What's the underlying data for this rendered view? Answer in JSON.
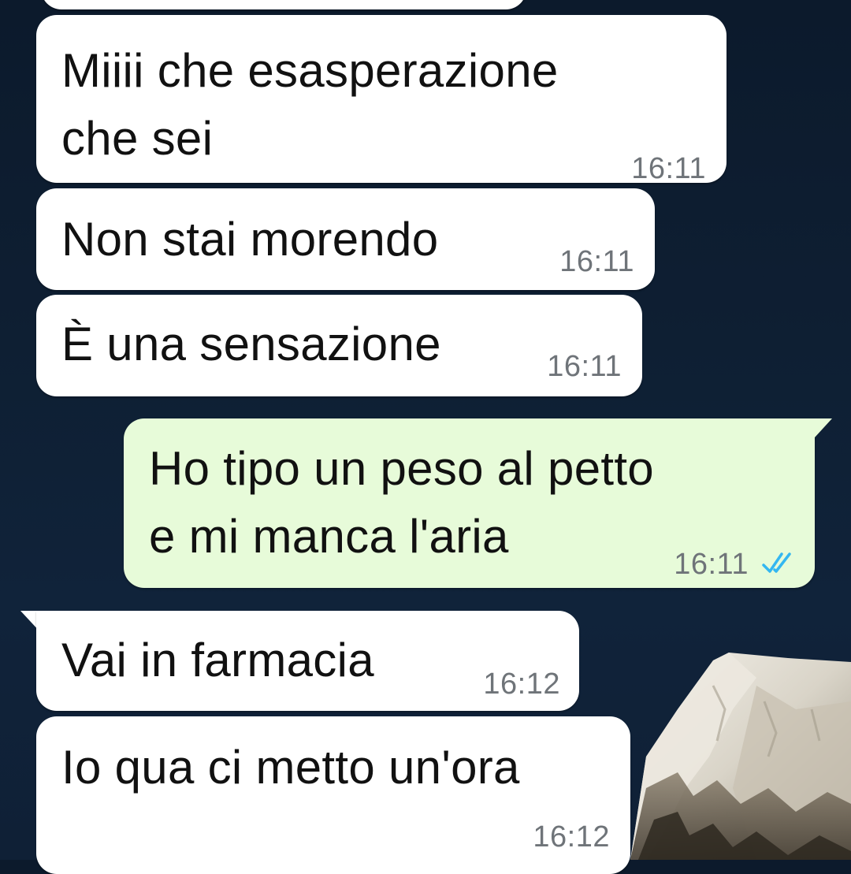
{
  "chat": {
    "messages": [
      {
        "direction": "incoming",
        "text": "",
        "time": ""
      },
      {
        "direction": "incoming",
        "text": "Miiii che esasperazione\nche sei",
        "time": "16:11"
      },
      {
        "direction": "incoming",
        "text": "Non stai morendo",
        "time": "16:11"
      },
      {
        "direction": "incoming",
        "text": "È una sensazione",
        "time": "16:11"
      },
      {
        "direction": "outgoing",
        "text": "Ho tipo un peso al petto\ne mi manca l'aria",
        "time": "16:11",
        "status": "read",
        "status_icon": "double-check-icon",
        "status_color": "#34b7f1"
      },
      {
        "direction": "incoming",
        "text": "Vai in farmacia",
        "time": "16:12"
      },
      {
        "direction": "incoming",
        "text": "Io qua ci metto un'ora",
        "time": "16:12"
      }
    ]
  },
  "colors": {
    "background": "#0e1f33",
    "incoming_bubble": "#ffffff",
    "outgoing_bubble": "#e7fbd9",
    "timestamp": "#6f7479",
    "read_ticks": "#34b7f1"
  }
}
